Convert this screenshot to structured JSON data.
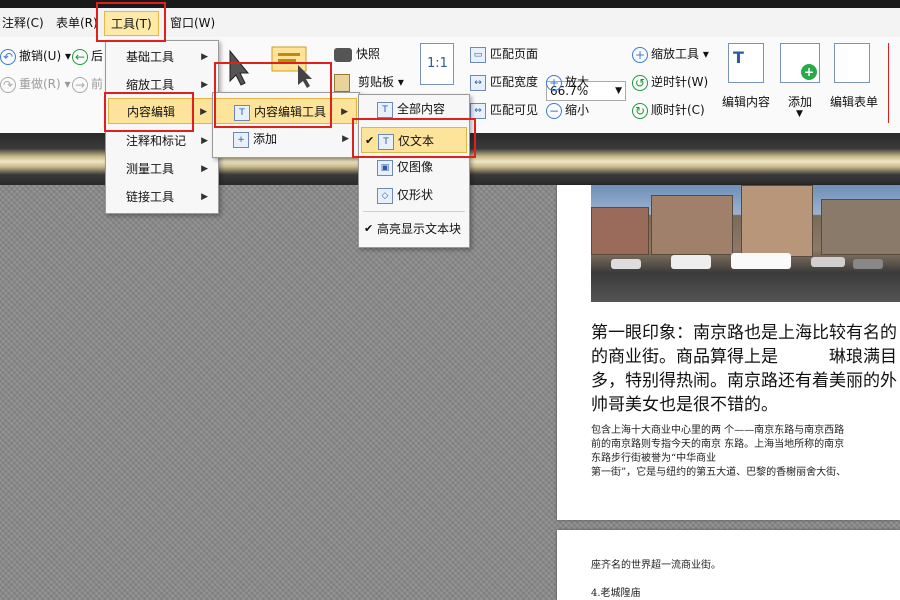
{
  "menubar": {
    "items": [
      "注释(C)",
      "表单(R)",
      "工具(T)",
      "窗口(W)"
    ]
  },
  "ribbon": {
    "undo": "撤销(U)",
    "redo": "重做(R)",
    "back_partial": "后",
    "fwd_partial": "前",
    "snapshot": "快照",
    "clipboard": "剪贴板",
    "fit_page": "匹配页面",
    "fit_width": "匹配宽度",
    "fit_visible": "匹配可见",
    "zoom_value": "66.7%",
    "zoom_tool": "缩放工具",
    "zoom_in": "放大",
    "zoom_out": "缩小",
    "rotate_ccw": "逆时针(W)",
    "rotate_cw": "顺时针(C)",
    "edit_content": "编辑内容",
    "add": "添加",
    "edit_form": "编辑表单",
    "one_to_one": "1:1"
  },
  "tools_menu": {
    "items": [
      "基础工具",
      "缩放工具",
      "内容编辑",
      "注释和标记",
      "测量工具",
      "链接工具"
    ]
  },
  "content_edit_menu": {
    "items": [
      "内容编辑工具",
      "添加"
    ]
  },
  "edit_tool_menu": {
    "items": [
      "全部内容",
      "仅文本",
      "仅图像",
      "仅形状",
      "高亮显示文本块"
    ]
  },
  "document": {
    "para1": [
      "第一眼印象：南京路也是上海比较有名的",
      "的商业街。商品算得上是　　　琳琅满目",
      "多，特别得热闹。南京路还有着美丽的外",
      "帅哥美女也是很不错的。"
    ],
    "para2": [
      "包含上海十大商业中心里的两 个——南京东路与南京西路",
      "前的南京路则专指今天的南京 东路。上海当地所称的南京",
      "东路步行街被誉为“中华商业",
      "第一街”，它是与纽约的第五大道、巴黎的香榭丽舍大街、"
    ],
    "page2_line1": "座齐名的世界超一流商业街。",
    "page2_line2": "4.老城隍庙"
  },
  "colors": {
    "highlight": "#fde49a",
    "annotation_red": "#e0201c"
  }
}
